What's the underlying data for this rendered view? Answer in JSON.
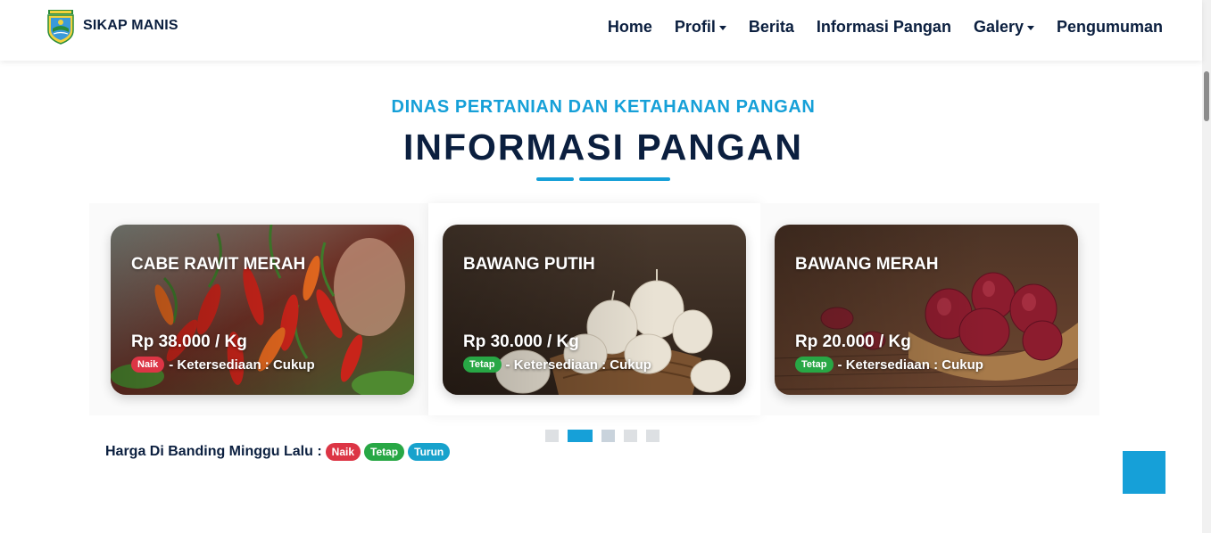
{
  "brand": {
    "name": "SIKAP MANIS",
    "logo_icon": "regency-emblem-icon"
  },
  "nav": [
    {
      "label": "Home",
      "dropdown": false
    },
    {
      "label": "Profil",
      "dropdown": true
    },
    {
      "label": "Berita",
      "dropdown": false
    },
    {
      "label": "Informasi Pangan",
      "dropdown": false
    },
    {
      "label": "Galery",
      "dropdown": true
    },
    {
      "label": "Pengumuman",
      "dropdown": false
    }
  ],
  "section": {
    "kicker": "DINAS PERTANIAN DAN KETAHANAN PANGAN",
    "title": "INFORMASI PANGAN"
  },
  "cards": [
    {
      "name": "CABE RAWIT MERAH",
      "price": "Rp 38.000 / Kg",
      "status": "Naik",
      "availability": "- Ketersediaan : Cukup",
      "image_icon": "chili-peppers-photo"
    },
    {
      "name": "BAWANG PUTIH",
      "price": "Rp 30.000 / Kg",
      "status": "Tetap",
      "availability": "- Ketersediaan : Cukup",
      "image_icon": "garlic-photo"
    },
    {
      "name": "BAWANG MERAH",
      "price": "Rp 20.000 / Kg",
      "status": "Tetap",
      "availability": "- Ketersediaan : Cukup",
      "image_icon": "shallots-photo"
    }
  ],
  "carousel": {
    "total_slides": 5,
    "active_slide": 2
  },
  "legend": {
    "label": "Harga Di Banding Minggu Lalu :",
    "naik": "Naik",
    "tetap": "Tetap",
    "turun": "Turun"
  },
  "colors": {
    "accent": "#16a0d8",
    "navy": "#0b1f3f",
    "naik": "#dc3545",
    "tetap": "#28a745",
    "turun": "#17a2cc"
  },
  "back_to_top": {
    "icon": "arrow-up-icon"
  }
}
